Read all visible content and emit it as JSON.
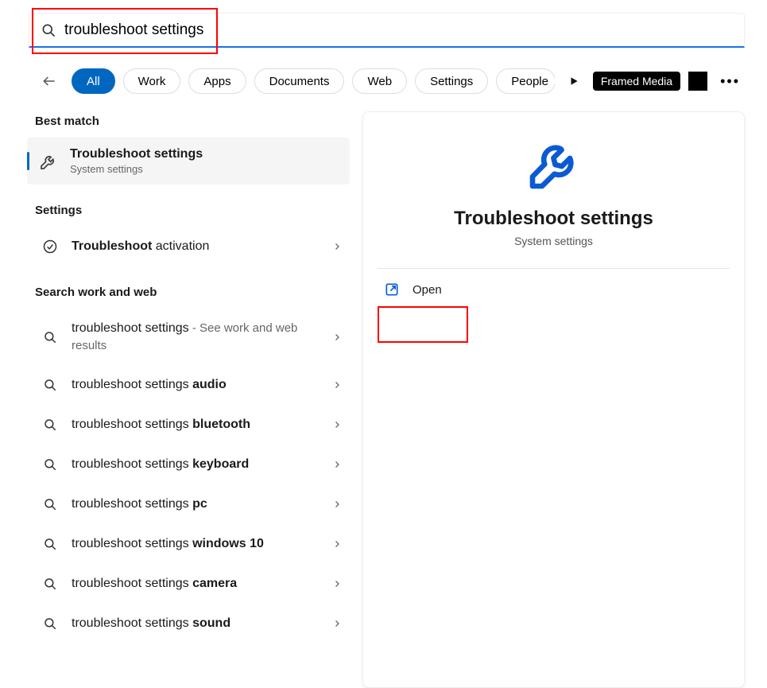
{
  "search": {
    "value": "troubleshoot settings"
  },
  "tabs": [
    "All",
    "Work",
    "Apps",
    "Documents",
    "Web",
    "Settings",
    "People"
  ],
  "framed_label": "Framed Media",
  "sections": {
    "best_match": "Best match",
    "settings": "Settings",
    "search_web": "Search work and web"
  },
  "best_match_item": {
    "title": "Troubleshoot settings",
    "subtitle": "System settings"
  },
  "settings_result": {
    "prefix_bold": "Troubleshoot",
    "rest": " activation"
  },
  "web_results": [
    {
      "prefix": "troubleshoot settings",
      "bold": "",
      "suffix_muted": " - See work and web results"
    },
    {
      "prefix": "troubleshoot settings ",
      "bold": "audio",
      "suffix_muted": ""
    },
    {
      "prefix": "troubleshoot settings ",
      "bold": "bluetooth",
      "suffix_muted": ""
    },
    {
      "prefix": "troubleshoot settings ",
      "bold": "keyboard",
      "suffix_muted": ""
    },
    {
      "prefix": "troubleshoot settings ",
      "bold": "pc",
      "suffix_muted": ""
    },
    {
      "prefix": "troubleshoot settings ",
      "bold": "windows 10",
      "suffix_muted": ""
    },
    {
      "prefix": "troubleshoot settings ",
      "bold": "camera",
      "suffix_muted": ""
    },
    {
      "prefix": "troubleshoot settings ",
      "bold": "sound",
      "suffix_muted": ""
    }
  ],
  "detail": {
    "title": "Troubleshoot settings",
    "subtitle": "System settings",
    "open_label": "Open"
  }
}
